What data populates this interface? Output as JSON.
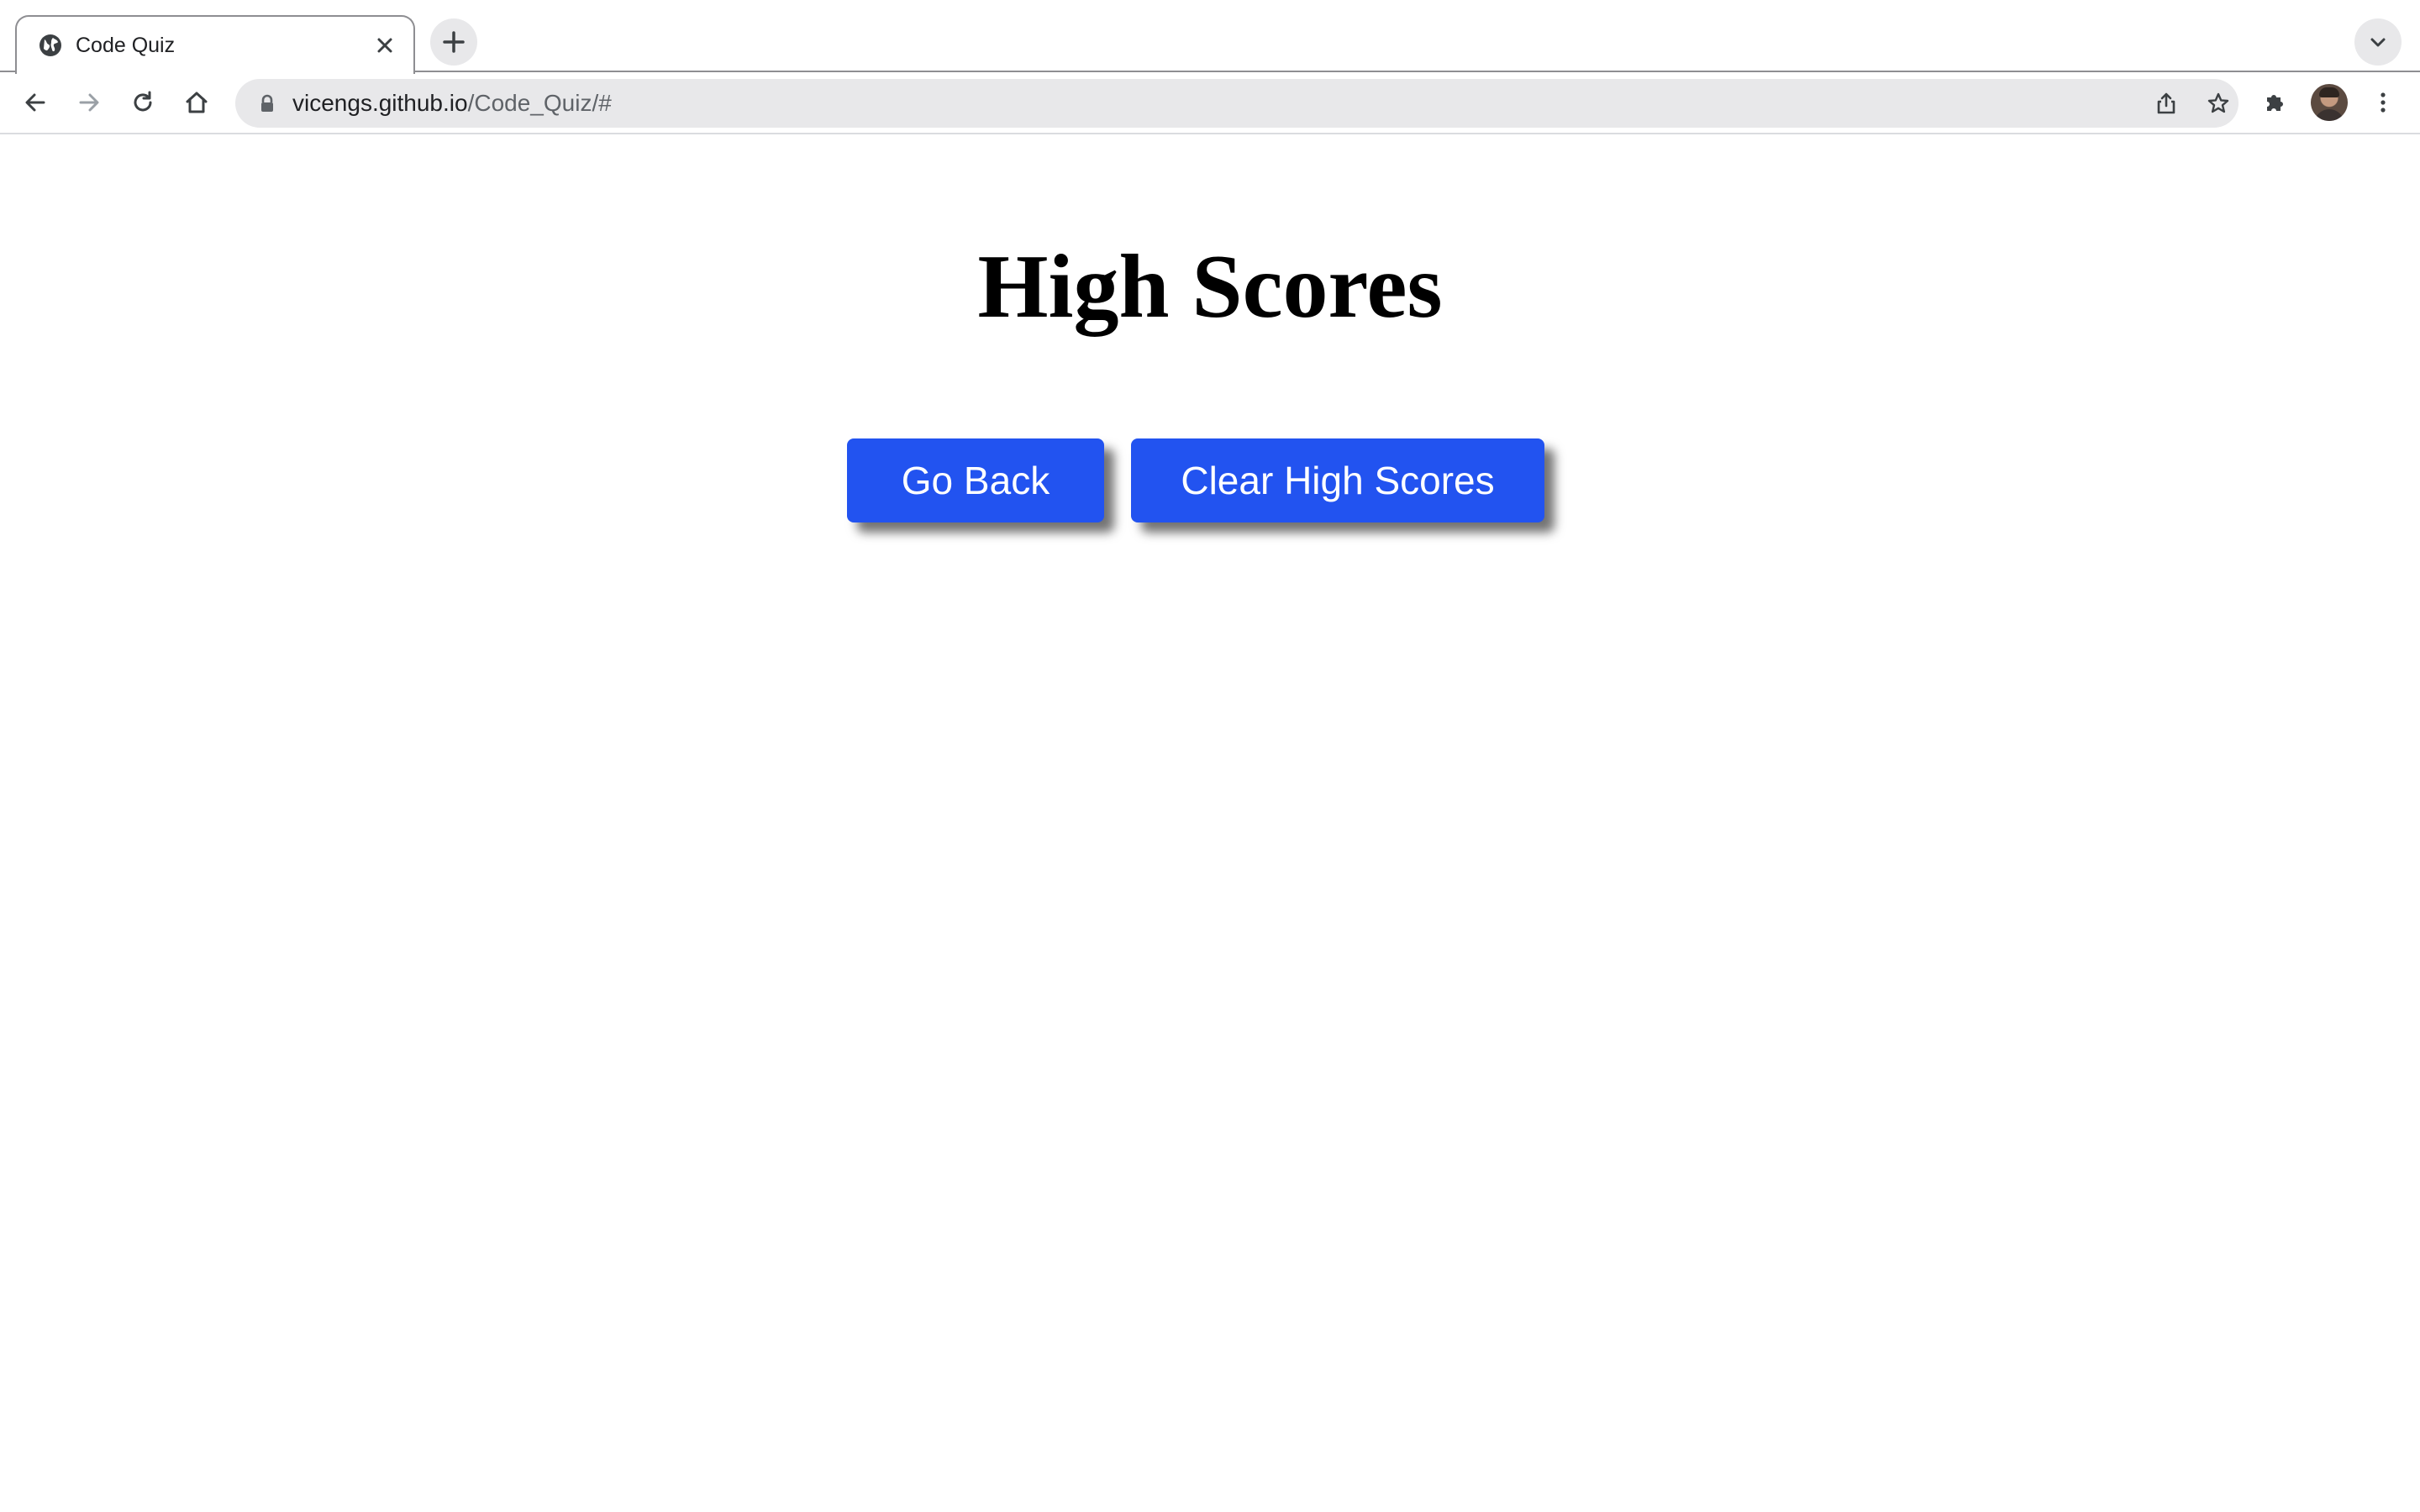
{
  "browser": {
    "tab": {
      "title": "Code Quiz",
      "favicon": "globe-icon"
    },
    "new_tab_icon": "plus-icon",
    "tab_search_icon": "chevron-down-icon",
    "toolbar": {
      "back_icon": "back-arrow-icon",
      "forward_icon": "forward-arrow-icon",
      "reload_icon": "reload-icon",
      "home_icon": "home-icon",
      "extensions_icon": "puzzle-icon",
      "menu_icon": "kebab-menu-icon"
    },
    "address_bar": {
      "host": "vicengs.github.io",
      "path": "/Code_Quiz/#",
      "lock_icon": "lock-icon",
      "share_icon": "share-icon",
      "bookmark_icon": "star-icon"
    }
  },
  "page": {
    "title": "High Scores",
    "buttons": {
      "go_back": "Go Back",
      "clear_high_scores": "Clear High Scores"
    },
    "colors": {
      "button_background": "#2253f0",
      "button_text": "#ffffff",
      "title_text": "#000000"
    }
  }
}
